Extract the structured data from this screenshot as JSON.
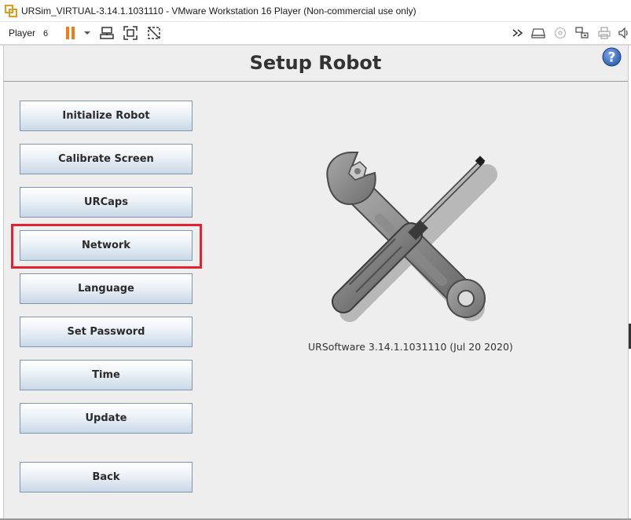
{
  "window": {
    "title": "URSim_VIRTUAL-3.14.1.1031110 - VMware Workstation 16 Player (Non-commercial use only)"
  },
  "toolbar": {
    "player_label": "Player",
    "player_dropdown_glyph": "6",
    "icons": [
      "pause-icon",
      "dropdown-arrow-icon",
      "send-ctrl-alt-del-icon",
      "fullscreen-icon",
      "unity-icon",
      "expand-icon",
      "hard-disk-icon",
      "cd-icon",
      "network-adapter-icon",
      "printer-icon",
      "sound-icon"
    ]
  },
  "page": {
    "title": "Setup Robot",
    "help_icon": "help-icon"
  },
  "menu": {
    "initialize": "Initialize Robot",
    "calibrate": "Calibrate Screen",
    "urcaps": "URCaps",
    "network": "Network",
    "language": "Language",
    "password": "Set Password",
    "time": "Time",
    "update": "Update",
    "back": "Back"
  },
  "version_text": "URSoftware 3.14.1.1031110 (Jul 20 2020)",
  "colors": {
    "highlight": "#e0232e",
    "pause_orange": "#f07d18",
    "button_border": "#7f96ad",
    "help_blue": "#2f62b0"
  }
}
